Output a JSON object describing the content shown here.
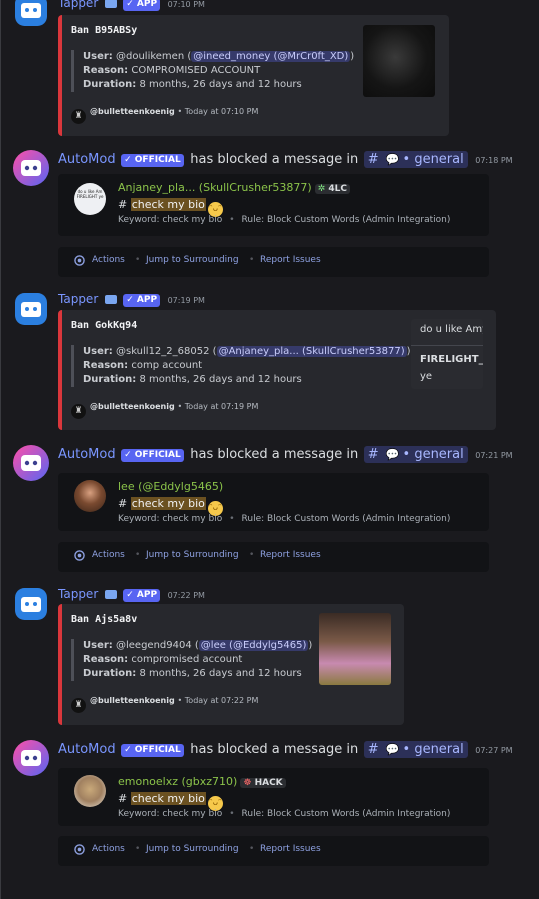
{
  "colors": {
    "background": "#1a1a1e",
    "bot_name": "#7a96ff",
    "ban_accent": "#da373c",
    "badge": "#5865f2",
    "username_green": "#8bc34a",
    "action_link": "#8ea1e1",
    "keyword_highlight": "#6b5121"
  },
  "messages": [
    {
      "kind": "ban",
      "author": "Tapper",
      "badge": "✓ APP",
      "time": "07:10 PM",
      "title": "Ban B95ABSy",
      "user_label": "User:",
      "user_value": "@doulikemen (",
      "user_mention": "@ineed_money (@MrCr0ft_XD)",
      "user_close": ")",
      "reason_label": "Reason:",
      "reason_value": "COMPROMISED ACCOUNT",
      "duration_label": "Duration:",
      "duration_value": "8 months, 26 days and 12 hours",
      "footer_user": "@bulletteenkoenig",
      "footer_time": "• Today at 07:10 PM"
    },
    {
      "kind": "automod",
      "author": "AutoMod",
      "badge": "✓ OFFICIAL",
      "action": "has blocked a message in",
      "channel": "general",
      "time": "07:18 PM",
      "avatar_text": "do u like Am FIRELIGHT ye",
      "username": "Anjaney_pla... (SkullCrusher53877)",
      "tag": "4LC",
      "content_prefix": "#",
      "keyword_text": "check my bio",
      "keyword_line": "Keyword: check my bio",
      "rule_line": "Rule: Block Custom Words (Admin Integration)",
      "actions": "Actions",
      "jump": "Jump to Surrounding",
      "report": "Report Issues"
    },
    {
      "kind": "ban",
      "author": "Tapper",
      "badge": "✓ APP",
      "time": "07:19 PM",
      "title": "Ban GokKq94",
      "user_label": "User:",
      "user_value": "@skull12_2_68052 (",
      "user_mention": "@Anjaney_pla... (SkullCrusher53877)",
      "user_close": ")",
      "reason_label": "Reason:",
      "reason_value": "comp account",
      "duration_label": "Duration:",
      "duration_value": "8 months, 26 days and 12 hours",
      "footer_user": "@bulletteenkoenig",
      "footer_time": "• Today at 07:19 PM",
      "side_line1": "do u like Amy",
      "side_line2": "FIRELIGHT_",
      "side_line3": "ye"
    },
    {
      "kind": "automod",
      "author": "AutoMod",
      "badge": "✓ OFFICIAL",
      "action": "has blocked a message in",
      "channel": "general",
      "time": "07:21 PM",
      "username": "lee (@Eddylg5465)",
      "content_prefix": "#",
      "keyword_text": "check my bio",
      "keyword_line": "Keyword: check my bio",
      "rule_line": "Rule: Block Custom Words (Admin Integration)",
      "actions": "Actions",
      "jump": "Jump to Surrounding",
      "report": "Report Issues"
    },
    {
      "kind": "ban",
      "author": "Tapper",
      "badge": "✓ APP",
      "time": "07:22 PM",
      "title": "Ban Ajs5a8v",
      "user_label": "User:",
      "user_value": "@leegend9404 (",
      "user_mention": "@lee (@Eddylg5465)",
      "user_close": ")",
      "reason_label": "Reason:",
      "reason_value": "compromised account",
      "duration_label": "Duration:",
      "duration_value": "8 months, 26 days and 12 hours",
      "footer_user": "@bulletteenkoenig",
      "footer_time": "• Today at 07:22 PM"
    },
    {
      "kind": "automod",
      "author": "AutoMod",
      "badge": "✓ OFFICIAL",
      "action": "has blocked a message in",
      "channel": "general",
      "time": "07:27 PM",
      "username": "emonoelxz (gbxz710)",
      "tag": "HACK",
      "content_prefix": "#",
      "keyword_text": "check my bio",
      "keyword_line": "Keyword: check my bio",
      "rule_line": "Rule: Block Custom Words (Admin Integration)",
      "actions": "Actions",
      "jump": "Jump to Surrounding",
      "report": "Report Issues"
    }
  ]
}
